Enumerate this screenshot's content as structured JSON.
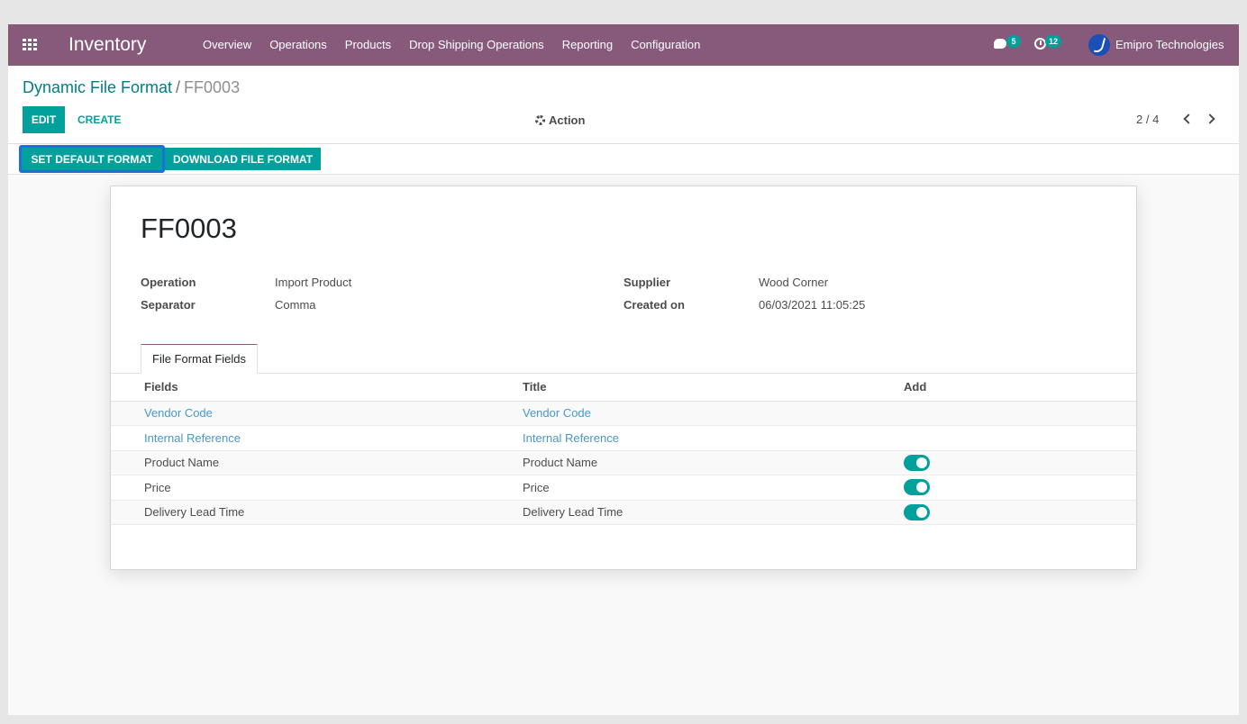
{
  "navbar": {
    "brand": "Inventory",
    "menu": [
      "Overview",
      "Operations",
      "Products",
      "Drop Shipping Operations",
      "Reporting",
      "Configuration"
    ],
    "messages_count": "5",
    "activities_count": "12",
    "company": "Emipro Technologies",
    "icons": {
      "apps": "apps-grid-icon",
      "chat": "chat-icon",
      "activity": "clock-icon"
    }
  },
  "control_panel": {
    "breadcrumb_parent": "Dynamic File Format",
    "breadcrumb_separator": "/",
    "breadcrumb_current": "FF0003",
    "edit_label": "EDIT",
    "create_label": "CREATE",
    "action_label": "Action",
    "pager": "2 / 4"
  },
  "statusbar": {
    "set_default_label": "SET DEFAULT FORMAT",
    "download_label": "DOWNLOAD FILE FORMAT"
  },
  "record": {
    "name": "FF0003",
    "operation_label": "Operation",
    "operation_value": "Import Product",
    "separator_label": "Separator",
    "separator_value": "Comma",
    "supplier_label": "Supplier",
    "supplier_value": "Wood Corner",
    "created_label": "Created on",
    "created_value": "06/03/2021 11:05:25"
  },
  "tab_label": "File Format Fields",
  "table": {
    "headers": [
      "Fields",
      "Title",
      "Add"
    ],
    "rows": [
      {
        "field": "Vendor Code",
        "title": "Vendor Code",
        "add": null,
        "link": true
      },
      {
        "field": "Internal Reference",
        "title": "Internal Reference",
        "add": null,
        "link": true
      },
      {
        "field": "Product Name",
        "title": "Product Name",
        "add": true,
        "link": false
      },
      {
        "field": "Price",
        "title": "Price",
        "add": true,
        "link": false
      },
      {
        "field": "Delivery Lead Time",
        "title": "Delivery Lead Time",
        "add": true,
        "link": false
      }
    ]
  },
  "colors": {
    "brand": "#875a7b",
    "primary": "#00a09d",
    "link": "#017e84"
  }
}
